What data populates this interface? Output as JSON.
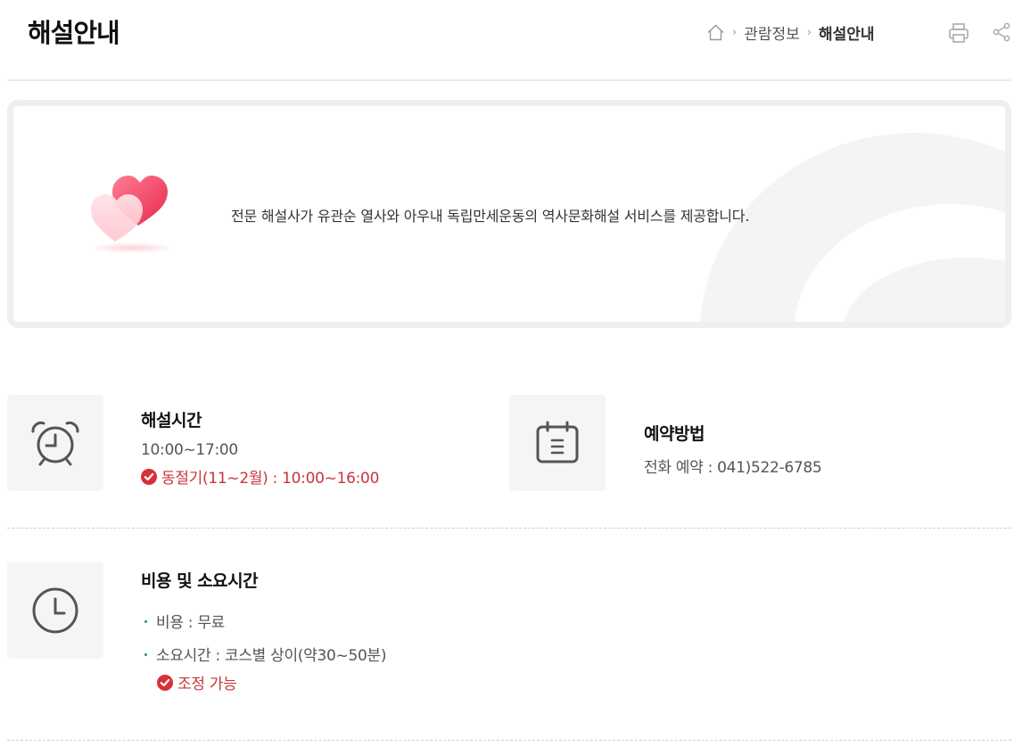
{
  "page": {
    "title": "해설안내"
  },
  "breadcrumb": {
    "items": [
      "관람정보",
      "해설안내"
    ]
  },
  "intro": {
    "text": "전문 해설사가 유관순 열사와 아우내 독립만세운동의 역사문화해설 서비스를 제공합니다."
  },
  "sections": {
    "hours": {
      "heading": "해설시간",
      "time": "10:00~17:00",
      "note": "동절기(11~2월) : 10:00~16:00"
    },
    "reservation": {
      "heading": "예약방법",
      "text": "전화 예약 : 041)522-6785"
    },
    "cost": {
      "heading": "비용 및 소요시간",
      "items": [
        "비용 : 무료",
        "소요시간 : 코스별 상이(약30~50분)"
      ],
      "note": "조정 가능"
    }
  },
  "colors": {
    "accent": "#c8343c",
    "bullet": "#2a8b7a",
    "tile": "#f5f5f5",
    "heart": "#f0476a"
  },
  "icons": [
    "home-icon",
    "print-icon",
    "share-icon",
    "hearts-icon",
    "alarm-clock-icon",
    "calendar-icon",
    "clock-icon",
    "check-icon"
  ]
}
